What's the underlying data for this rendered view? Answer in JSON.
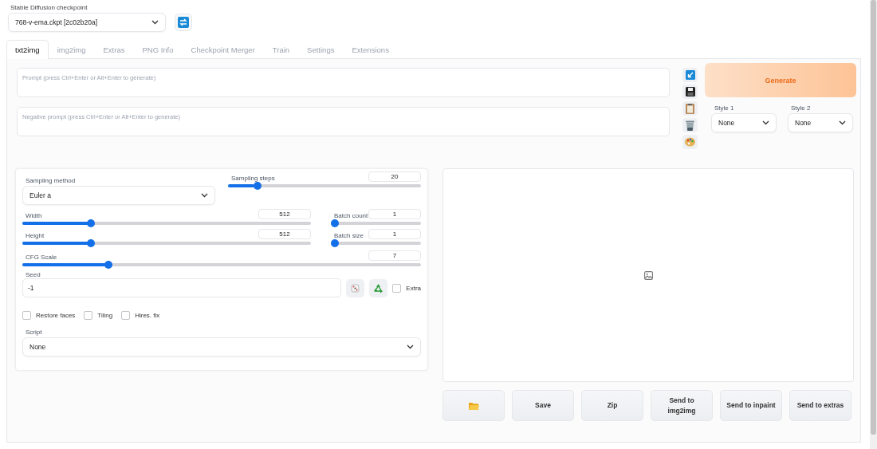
{
  "checkpoint": {
    "label": "Stable Diffusion checkpoint",
    "value": "768-v-ema.ckpt [2c02b20a]"
  },
  "tabs": [
    {
      "label": "txt2img",
      "selected": true
    },
    {
      "label": "img2img",
      "selected": false
    },
    {
      "label": "Extras",
      "selected": false
    },
    {
      "label": "PNG Info",
      "selected": false
    },
    {
      "label": "Checkpoint Merger",
      "selected": false
    },
    {
      "label": "Train",
      "selected": false
    },
    {
      "label": "Settings",
      "selected": false
    },
    {
      "label": "Extensions",
      "selected": false
    }
  ],
  "prompt": {
    "placeholder": "Prompt (press Ctrl+Enter or Alt+Enter to generate)"
  },
  "negative_prompt": {
    "placeholder": "Negative prompt (press Ctrl+Enter or Alt+Enter to generate)"
  },
  "generate_button": "Generate",
  "styles": [
    {
      "label": "Style 1",
      "value": "None"
    },
    {
      "label": "Style 2",
      "value": "None"
    }
  ],
  "sampling_method": {
    "label": "Sampling method",
    "value": "Euler a"
  },
  "sliders": [
    {
      "label": "Sampling steps",
      "value": "20",
      "level": 0.136
    },
    {
      "label": "Width",
      "value": "512",
      "level": 0.23
    },
    {
      "label": "Batch count",
      "value": "1",
      "level": 0
    },
    {
      "label": "Height",
      "value": "512",
      "level": 0.23
    },
    {
      "label": "Batch size",
      "value": "1",
      "level": 0
    },
    {
      "label": "CFG Scale",
      "value": "7",
      "level": 0.21
    }
  ],
  "seed": {
    "label": "Seed",
    "value": "-1"
  },
  "extra": {
    "label": "Extra",
    "checked": false
  },
  "options": [
    {
      "label": "Restore faces",
      "checked": false
    },
    {
      "label": "Tiling",
      "checked": false
    },
    {
      "label": "Hires. fix",
      "checked": false
    }
  ],
  "script": {
    "label": "Script",
    "value": "None"
  },
  "output_buttons": [
    {
      "kind": "folder"
    },
    {
      "kind": "text",
      "label": "Save"
    },
    {
      "kind": "text",
      "label": "Zip"
    },
    {
      "kind": "text",
      "label": "Send to\nimg2img"
    },
    {
      "kind": "text",
      "label": "Send to inpaint"
    },
    {
      "kind": "text",
      "label": "Send to extras"
    }
  ]
}
